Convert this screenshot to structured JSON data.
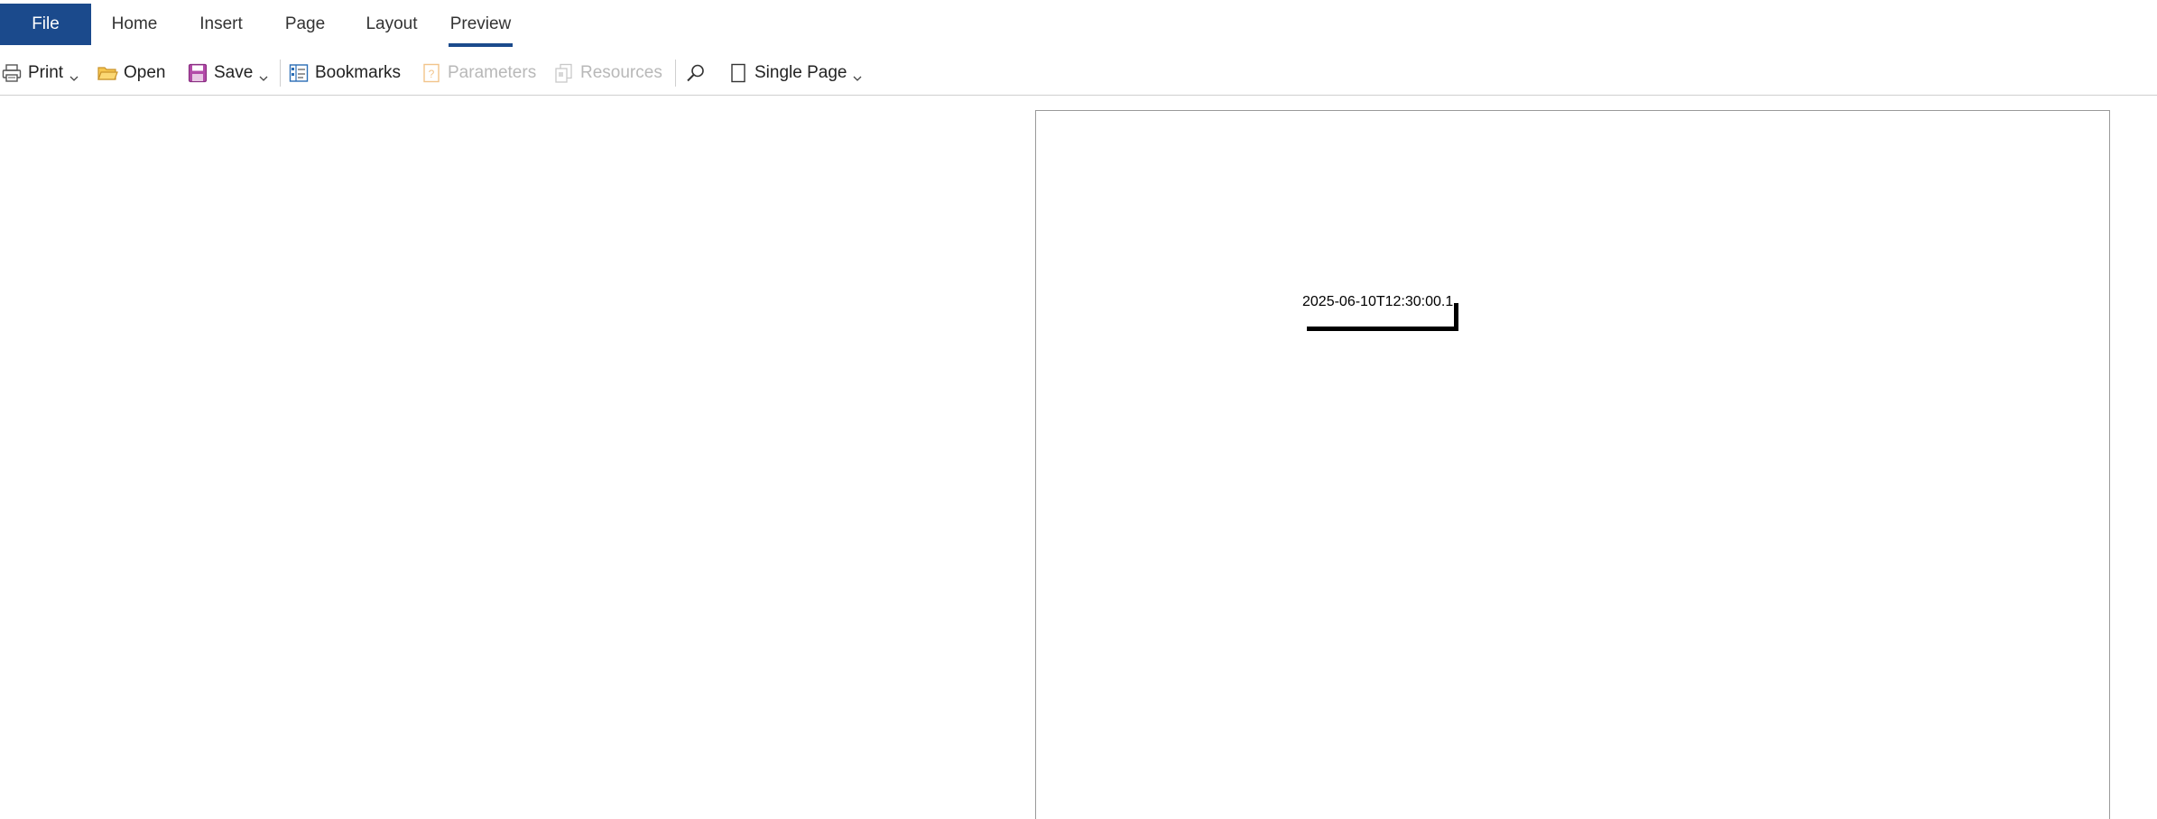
{
  "ribbon": {
    "tabs": [
      {
        "label": "File"
      },
      {
        "label": "Home"
      },
      {
        "label": "Insert"
      },
      {
        "label": "Page"
      },
      {
        "label": "Layout"
      },
      {
        "label": "Preview"
      }
    ],
    "active_tab": "Preview",
    "accent_color": "#1b4a8c"
  },
  "toolbar": {
    "print_label": "Print",
    "open_label": "Open",
    "save_label": "Save",
    "bookmarks_label": "Bookmarks",
    "parameters_label": "Parameters",
    "resources_label": "Resources",
    "view_mode_label": "Single Page",
    "icons": [
      "printer-icon",
      "folder-icon",
      "save-icon",
      "bookmarks-icon",
      "parameters-icon",
      "resources-icon",
      "search-icon",
      "page-icon"
    ]
  },
  "document": {
    "field_value": "2025-06-10T12:30:00.1"
  }
}
